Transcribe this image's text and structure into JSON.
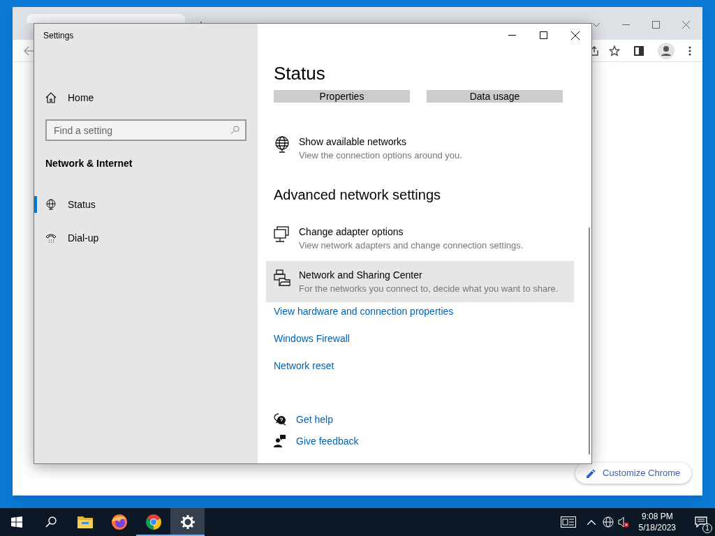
{
  "browser": {
    "customize_button": "Customize Chrome"
  },
  "settings": {
    "title": "Settings",
    "home": "Home",
    "search": {
      "placeholder": "Find a setting"
    },
    "section": "Network & Internet",
    "nav": [
      {
        "label": "Status",
        "selected": true
      },
      {
        "label": "Dial-up",
        "selected": false
      }
    ],
    "page_title": "Status",
    "top_buttons": [
      "Properties",
      "Data usage"
    ],
    "items": [
      {
        "title": "Show available networks",
        "description": "View the connection options around you.",
        "hovered": false
      }
    ],
    "advanced_heading": "Advanced network settings",
    "advanced_items": [
      {
        "title": "Change adapter options",
        "description": "View network adapters and change connection settings.",
        "hovered": false
      },
      {
        "title": "Network and Sharing Center",
        "description": "For the networks you connect to, decide what you want to share.",
        "hovered": true
      }
    ],
    "links": [
      "View hardware and connection properties",
      "Windows Firewall",
      "Network reset"
    ],
    "help_links": [
      "Get help",
      "Give feedback"
    ]
  },
  "taskbar": {
    "apps": [
      {
        "running": false,
        "selected": false
      },
      {
        "running": false,
        "selected": false
      },
      {
        "running": false,
        "selected": false
      },
      {
        "running": true,
        "selected": false
      },
      {
        "running": true,
        "selected": true
      }
    ],
    "time": "9:08 PM",
    "date": "5/18/2023",
    "notification_count": "1"
  }
}
